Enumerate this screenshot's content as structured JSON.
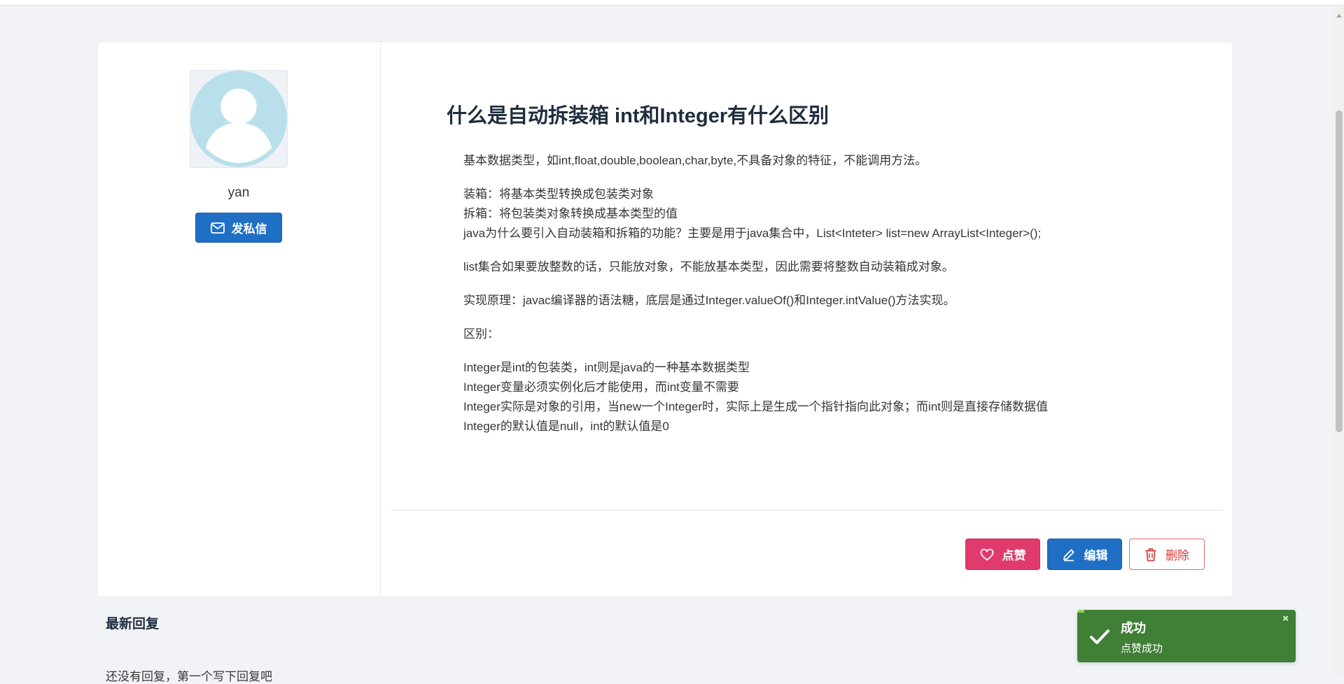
{
  "profile": {
    "username": "yan",
    "pm_button_label": "发私信"
  },
  "post": {
    "title": "什么是自动拆装箱 int和Integer有什么区别",
    "paragraphs": [
      [
        "基本数据类型，如int,float,double,boolean,char,byte,不具备对象的特征，不能调用方法。"
      ],
      [
        "装箱：将基本类型转换成包装类对象",
        "拆箱：将包装类对象转换成基本类型的值",
        "java为什么要引入自动装箱和拆箱的功能？主要是用于java集合中，List<Inteter> list=new ArrayList<Integer>();"
      ],
      [
        "list集合如果要放整数的话，只能放对象，不能放基本类型，因此需要将整数自动装箱成对象。"
      ],
      [
        "实现原理：javac编译器的语法糖，底层是通过Integer.valueOf()和Integer.intValue()方法实现。"
      ],
      [
        "区别："
      ],
      [
        "Integer是int的包装类，int则是java的一种基本数据类型",
        "Integer变量必须实例化后才能使用，而int变量不需要",
        "Integer实际是对象的引用，当new一个Integer时，实际上是生成一个指针指向此对象；而int则是直接存储数据值",
        "Integer的默认值是null，int的默认值是0"
      ]
    ],
    "actions": {
      "like_label": "点赞",
      "edit_label": "编辑",
      "delete_label": "删除"
    }
  },
  "replies": {
    "title": "最新回复",
    "empty_text": "还没有回复，第一个写下回复吧"
  },
  "toast": {
    "title": "成功",
    "message": "点赞成功",
    "close_symbol": "×"
  },
  "colors": {
    "primary": "#1f6fc5",
    "like": "#e03b6c",
    "danger": "#d63a3a",
    "toast_success": "#3f7f36"
  }
}
